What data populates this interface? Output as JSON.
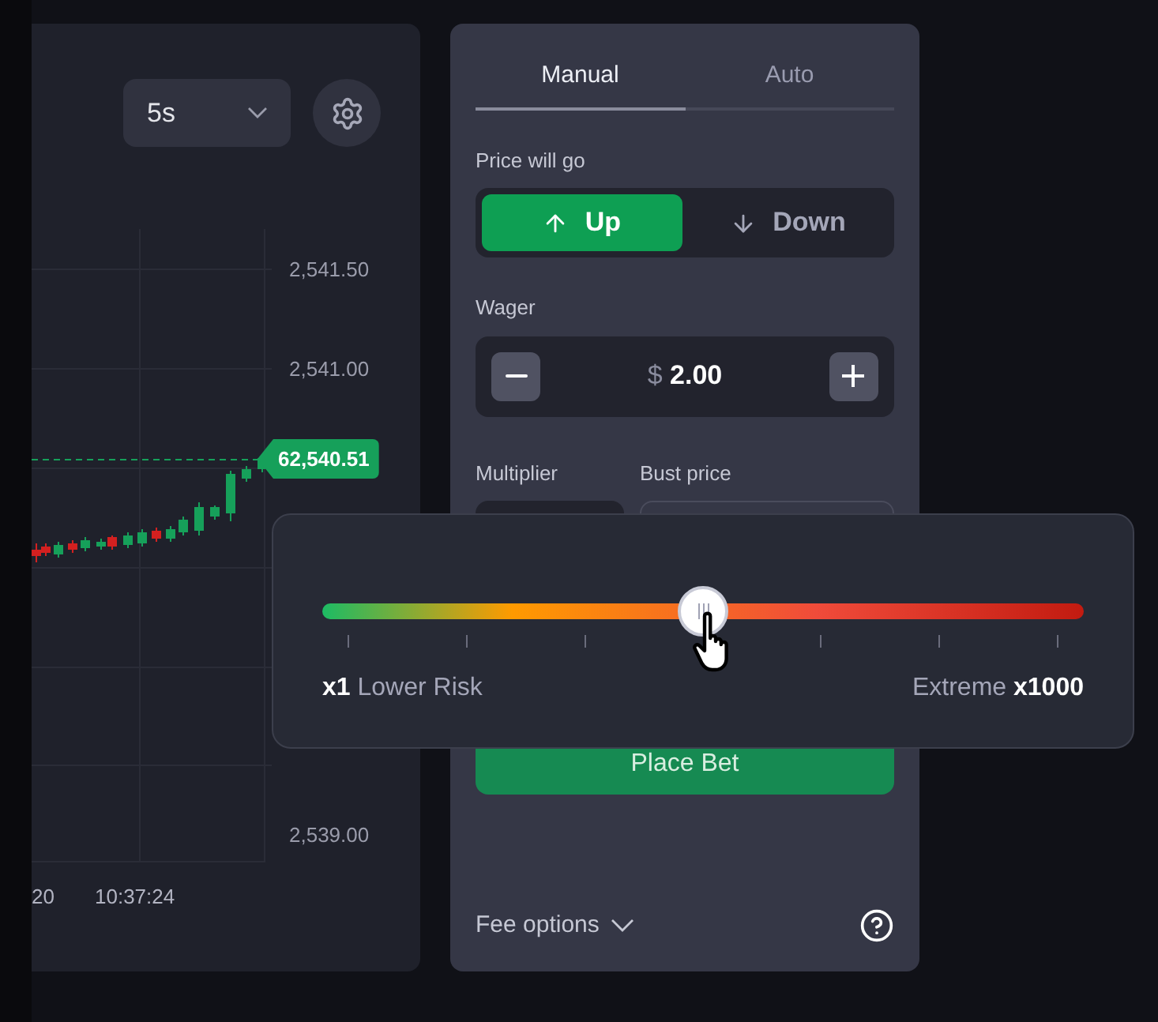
{
  "chart": {
    "interval": "5s",
    "price_axis": [
      "2,541.50",
      "2,541.00",
      "2,539.00"
    ],
    "current_price": "62,540.51",
    "time_labels": [
      "20",
      "10:37:24"
    ]
  },
  "bet_panel": {
    "tabs": [
      {
        "label": "Manual",
        "selected": true
      },
      {
        "label": "Auto",
        "selected": false
      }
    ],
    "direction_label": "Price will go",
    "directions": [
      {
        "label": "Up",
        "kind": "up",
        "selected": true
      },
      {
        "label": "Down",
        "kind": "down",
        "selected": false
      }
    ],
    "wager": {
      "label": "Wager",
      "currency": "$",
      "value": "2.00"
    },
    "multiplier_label": "Multiplier",
    "bust_price_label": "Bust price",
    "place_bet": "Place Bet",
    "fee_options": "Fee options"
  },
  "risk_popover": {
    "level": 0.5,
    "min_value": "x1",
    "min_label": "Lower Risk",
    "max_label": "Extreme",
    "max_value": "x1000"
  }
}
